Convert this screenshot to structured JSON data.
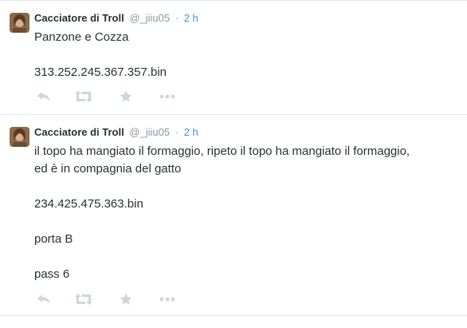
{
  "colors": {
    "name": "#292f33",
    "muted": "#8899a6",
    "time_link": "#3b94d9",
    "icon": "#ccd6dd",
    "divider": "#e1e8ed"
  },
  "tweets": [
    {
      "name": "Cacciatore di Troll",
      "handle": "@_jiiu05",
      "separator": "·",
      "time": "2 h",
      "lines": [
        "Panzone e Cozza",
        "",
        "313.252.245.367.357.bin"
      ]
    },
    {
      "name": "Cacciatore di Troll",
      "handle": "@_jiiu05",
      "separator": "·",
      "time": "2 h",
      "lines": [
        "il topo ha mangiato il formaggio, ripeto il topo ha mangiato il formaggio,",
        "ed è in compagnia del gatto",
        "",
        "234.425.475.363.bin",
        "",
        "porta B",
        "",
        "pass 6"
      ]
    }
  ],
  "icons": {
    "reply": "reply-icon",
    "retweet": "retweet-icon",
    "favorite": "star-icon",
    "more": "more-icon"
  }
}
